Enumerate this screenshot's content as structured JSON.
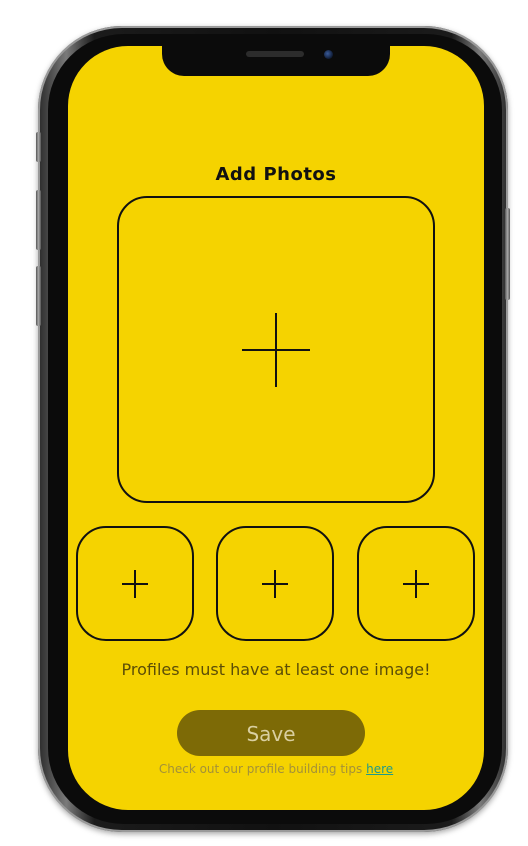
{
  "screen": {
    "title": "Add Photos",
    "notice": "Profiles must have at least one image!",
    "save_label": "Save",
    "tips_text": "Check out our profile building tips",
    "tips_link": "here"
  },
  "colors": {
    "background": "#f5d300",
    "button": "#7d6a06",
    "link": "#1f9a8a"
  },
  "icons": {
    "add": "plus-icon"
  }
}
